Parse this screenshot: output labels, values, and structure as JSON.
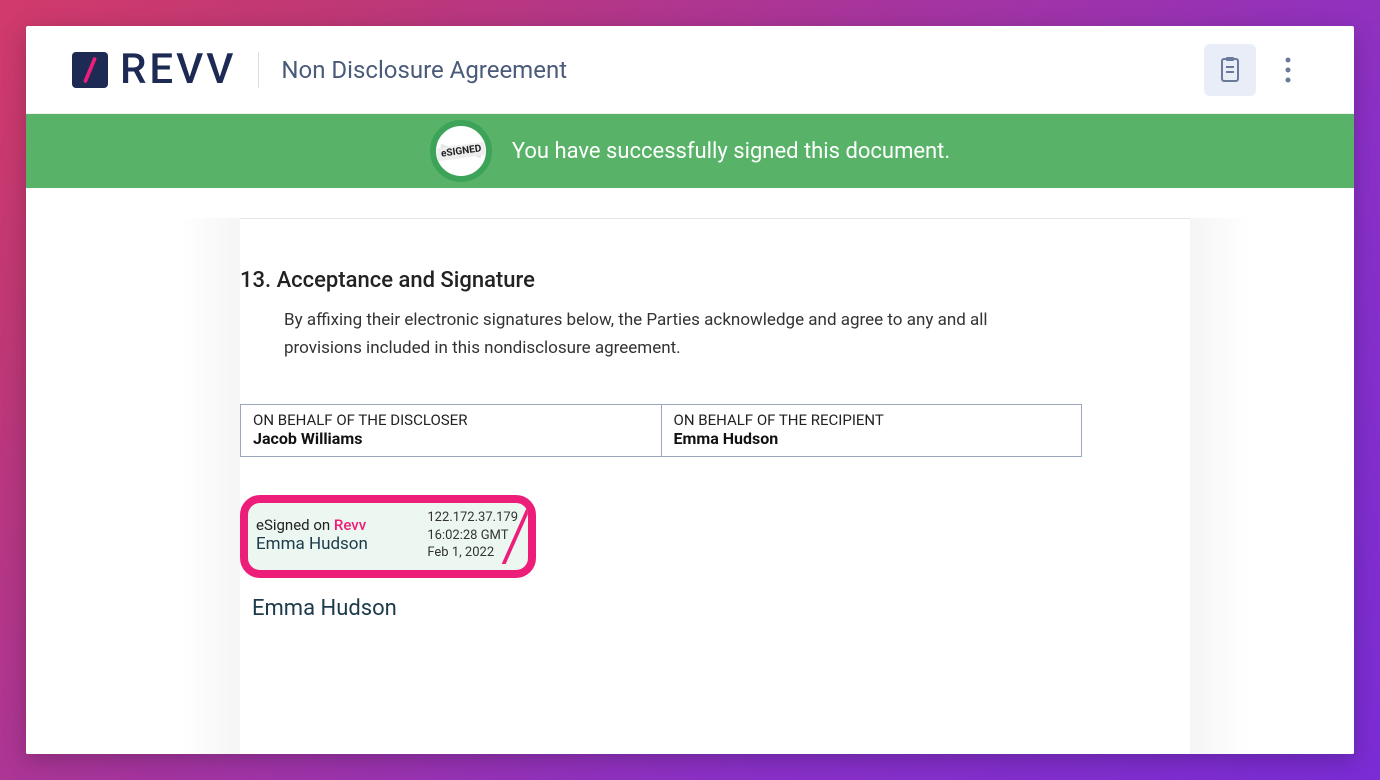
{
  "header": {
    "brand_text": "REVV",
    "doc_title": "Non Disclosure Agreement"
  },
  "banner": {
    "badge_label": "eSIGNED",
    "message": "You have successfully signed this document."
  },
  "section": {
    "heading": "13. Acceptance and Signature",
    "body": "By affixing their electronic signatures below, the Parties acknowledge and agree to any and all provisions included in this nondisclosure agreement."
  },
  "parties": {
    "discloser_role": "ON BEHALF OF THE DISCLOSER",
    "discloser_name": "Jacob Williams",
    "recipient_role": "ON BEHALF OF THE RECIPIENT",
    "recipient_name": "Emma Hudson"
  },
  "signature_stamp": {
    "prefix": "eSigned on ",
    "brand": "Revv",
    "signer": "Emma Hudson",
    "ip": "122.172.37.179",
    "time": "16:02:28 GMT",
    "date": "Feb 1, 2022"
  },
  "printed_name": "Emma Hudson"
}
